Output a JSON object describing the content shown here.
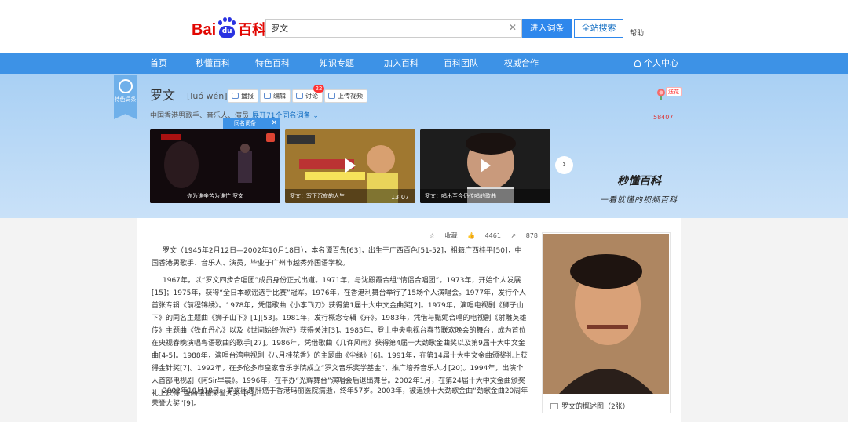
{
  "logo": {
    "bai": "Bai",
    "du": "du",
    "baike": "百科"
  },
  "search": {
    "value": "罗文",
    "enter_label": "进入词条",
    "site_label": "全站搜索",
    "help_label": "帮助"
  },
  "nav": {
    "items": [
      "首页",
      "秒懂百科",
      "特色百科",
      "知识专题",
      "加入百科",
      "百科团队",
      "权威合作"
    ],
    "user_label": "个人中心"
  },
  "entry": {
    "ribbon": "特色词条",
    "title": "罗文",
    "pinyin": "[luó wén]",
    "tools": [
      "播报",
      "编辑",
      "讨论",
      "上传视频"
    ],
    "discuss_count": "22",
    "description": "中国香港男歌手、音乐人、演员",
    "expand_label": "展开71个同名词条",
    "popup_label": "同名词条",
    "gift_tag": "送花",
    "gift_count": "58407"
  },
  "videos": [
    {
      "caption": "你为谁辛苦为谁忙 罗文",
      "duration": ""
    },
    {
      "caption": "罗文：写下沉寂的人生",
      "duration": "13:07"
    },
    {
      "caption": "罗文：唱出至今仍传唱的歌曲",
      "duration": ""
    }
  ],
  "brand": {
    "name": "秒懂百科",
    "slogan": "一看就懂的视频百科"
  },
  "stats": {
    "collect": "收藏",
    "likes": "4461",
    "shares": "878"
  },
  "summary": [
    "罗文（1945年2月12日—2002年10月18日），本名谭百先[63]，出生于广西百色[51-52]，祖籍广西桂平[50]，中国香港男歌手、音乐人、演员，毕业于广州市越秀外国语学校。",
    "1967年，以“罗文四步合唱团”成员身份正式出道。1971年，与沈殿霞合组“情侣合唱团”。1973年，开始个人发展[15]；1975年，获得“全日本歌谣选手比赛”冠军。1976年，在香港利舞台举行了15场个人演唱会。1977年，发行个人首张专辑《前程锦绣》。1978年，凭借歌曲《小李飞刀》获得第1届十大中文金曲奖[2]。1979年，演唱电视剧《狮子山下》的同名主题曲《狮子山下》[1][53]。1981年，发行概念专辑《卉》。1983年，凭借与甄妮合唱的电视剧《射雕英雄传》主题曲《铁血丹心》以及《世间始终你好》获得关注[3]。1985年，登上中央电视台春节联欢晚会的舞台，成为首位在央视春晚演唱粤语歌曲的歌手[27]。1986年，凭借歌曲《几许风雨》获得第4届十大劲歌金曲奖以及第9届十大中文金曲[4-5]。1988年，演唱台湾电视剧《八月桂花香》的主题曲《尘缘》[6]。1991年，在第14届十大中文金曲颁奖礼上获得金针奖[7]。1992年，在多伦多市皇家音乐学院成立“罗文音乐奖学基金”，推广培养音乐人才[20]。1994年，出演个人首部电视剧《阿Sir早晨》。1996年，在平办“光辉舞台”演唱会后退出舞台。2002年1月，在第24届十大中文金曲颁奖礼上获得“金曲银禧荣誉大奖”[8]。",
    "2002年10月18日，罗文因患肝癌于香港玛丽医院病逝，终年57岁。2003年，被追颁十大劲歌金曲“劲歌金曲20周年荣誉大奖”[9]。"
  ],
  "portrait_caption": "罗文的概述图（2张）"
}
